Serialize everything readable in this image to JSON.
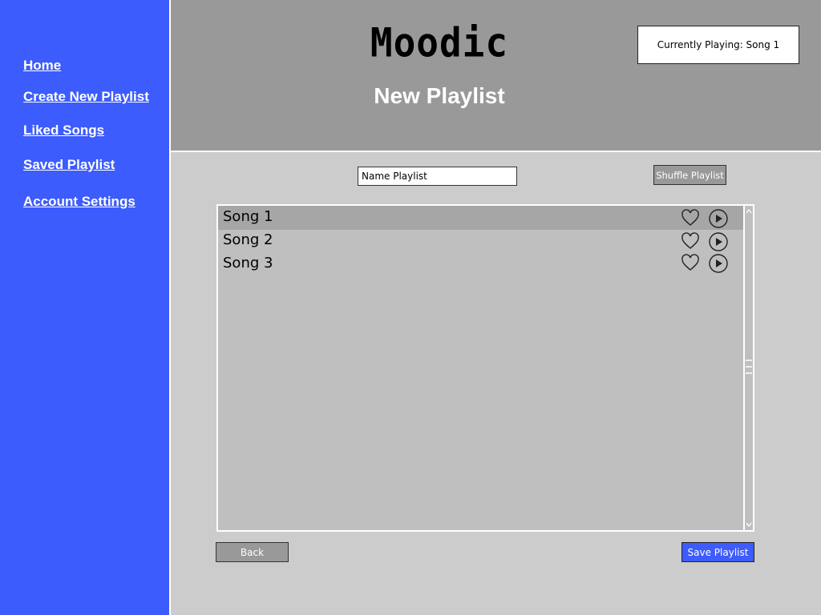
{
  "app": {
    "title": "Moodic"
  },
  "colors": {
    "sidebar": "#3d5cfd",
    "header": "#999999",
    "content": "#cccccc",
    "list": "#bfbfbf",
    "selected_row": "#a6a6a6",
    "save_button": "#3d5cfd"
  },
  "sidebar": {
    "items": [
      {
        "label": "Home"
      },
      {
        "label": "Create New Playlist"
      },
      {
        "label": "Liked Songs"
      },
      {
        "label": "Saved Playlist"
      },
      {
        "label": "Account Settings"
      }
    ]
  },
  "header": {
    "page_title": "New Playlist",
    "now_playing": "Currently Playing: Song 1"
  },
  "controls": {
    "name_value": "Name Playlist",
    "shuffle_label": "Shuffle Playlist"
  },
  "songs": [
    {
      "title": "Song 1",
      "icons": [
        "heart-icon",
        "play-icon"
      ]
    },
    {
      "title": "Song 2",
      "icons": [
        "heart-icon",
        "play-icon"
      ]
    },
    {
      "title": "Song 3",
      "icons": [
        "heart-icon",
        "play-icon"
      ]
    }
  ],
  "selected_song": "Song 1",
  "footer": {
    "back_label": "Back",
    "save_label": "Save Playlist"
  }
}
